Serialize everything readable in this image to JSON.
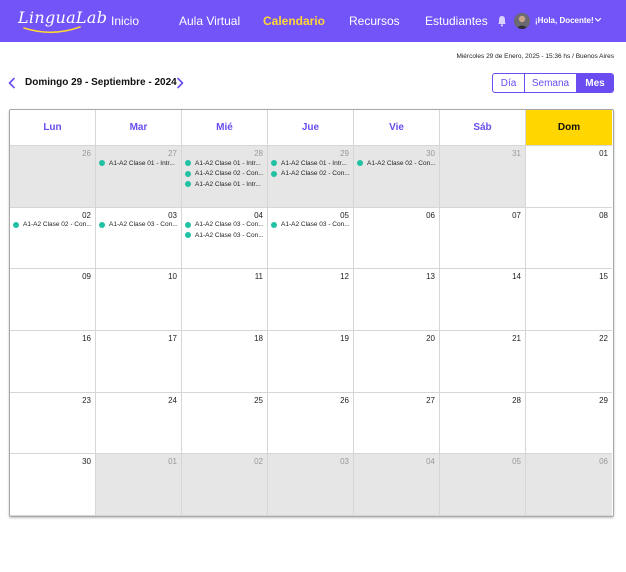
{
  "brand": {
    "name": "LinguaLab"
  },
  "nav": [
    {
      "label": "Inicio",
      "active": false
    },
    {
      "label": "Aula Virtual",
      "active": false
    },
    {
      "label": "Calendario",
      "active": true
    },
    {
      "label": "Recursos",
      "active": false
    },
    {
      "label": "Estudiantes",
      "active": false
    }
  ],
  "user": {
    "greeting": "¡Hola, Docente!",
    "icons": {
      "notifications": "bell-icon",
      "menu": "chevron-down-icon"
    }
  },
  "datetime": "Miércoles 29 de Enero, 2025 - 15:36 hs / Buenos Aires",
  "period": "Domingo 29 - Septiembre - 2024",
  "view": {
    "options": [
      "Día",
      "Semana",
      "Mes"
    ],
    "active": "Mes"
  },
  "colors": {
    "brand": "#7254f8",
    "accent": "#6a4cf0",
    "active_nav": "#ffd633",
    "today": "#ffd600",
    "event_dot": "#22c1a3"
  },
  "weekdays": [
    "Lun",
    "Mar",
    "Mié",
    "Jue",
    "Vie",
    "Sáb",
    "Dom"
  ],
  "weeks": [
    [
      {
        "day": "26",
        "other": true,
        "events": []
      },
      {
        "day": "27",
        "other": true,
        "events": [
          "A1-A2 Clase 01 - Intr..."
        ]
      },
      {
        "day": "28",
        "other": true,
        "events": [
          "A1-A2 Clase 01 - Intr...",
          "A1-A2 Clase 02 - Con...",
          "A1-A2 Clase 01 - Intr..."
        ]
      },
      {
        "day": "29",
        "other": true,
        "events": [
          "A1-A2 Clase 01 - Intr...",
          "A1-A2 Clase 02 - Con..."
        ]
      },
      {
        "day": "30",
        "other": true,
        "events": [
          "A1-A2 Clase 02 - Con..."
        ]
      },
      {
        "day": "31",
        "other": true,
        "events": []
      },
      {
        "day": "01",
        "other": false,
        "events": []
      }
    ],
    [
      {
        "day": "02",
        "other": false,
        "events": [
          "A1-A2 Clase 02 - Con..."
        ]
      },
      {
        "day": "03",
        "other": false,
        "events": [
          "A1-A2 Clase 03 - Con..."
        ]
      },
      {
        "day": "04",
        "other": false,
        "events": [
          "A1-A2 Clase 03 - Con...",
          "A1-A2 Clase 03 - Con..."
        ]
      },
      {
        "day": "05",
        "other": false,
        "events": [
          "A1-A2 Clase 03 - Con..."
        ]
      },
      {
        "day": "06",
        "other": false,
        "events": []
      },
      {
        "day": "07",
        "other": false,
        "events": []
      },
      {
        "day": "08",
        "other": false,
        "events": []
      }
    ],
    [
      {
        "day": "09",
        "other": false,
        "events": []
      },
      {
        "day": "10",
        "other": false,
        "events": []
      },
      {
        "day": "11",
        "other": false,
        "events": []
      },
      {
        "day": "12",
        "other": false,
        "events": []
      },
      {
        "day": "13",
        "other": false,
        "events": []
      },
      {
        "day": "14",
        "other": false,
        "events": []
      },
      {
        "day": "15",
        "other": false,
        "events": []
      }
    ],
    [
      {
        "day": "16",
        "other": false,
        "events": []
      },
      {
        "day": "17",
        "other": false,
        "events": []
      },
      {
        "day": "18",
        "other": false,
        "events": []
      },
      {
        "day": "19",
        "other": false,
        "events": []
      },
      {
        "day": "20",
        "other": false,
        "events": []
      },
      {
        "day": "21",
        "other": false,
        "events": []
      },
      {
        "day": "22",
        "other": false,
        "events": []
      }
    ],
    [
      {
        "day": "23",
        "other": false,
        "events": []
      },
      {
        "day": "24",
        "other": false,
        "events": []
      },
      {
        "day": "25",
        "other": false,
        "events": []
      },
      {
        "day": "26",
        "other": false,
        "events": []
      },
      {
        "day": "27",
        "other": false,
        "events": []
      },
      {
        "day": "28",
        "other": false,
        "events": []
      },
      {
        "day": "29",
        "other": false,
        "events": []
      }
    ],
    [
      {
        "day": "30",
        "other": false,
        "events": []
      },
      {
        "day": "01",
        "other": true,
        "events": []
      },
      {
        "day": "02",
        "other": true,
        "events": []
      },
      {
        "day": "03",
        "other": true,
        "events": []
      },
      {
        "day": "04",
        "other": true,
        "events": []
      },
      {
        "day": "05",
        "other": true,
        "events": []
      },
      {
        "day": "06",
        "other": true,
        "events": []
      }
    ]
  ]
}
